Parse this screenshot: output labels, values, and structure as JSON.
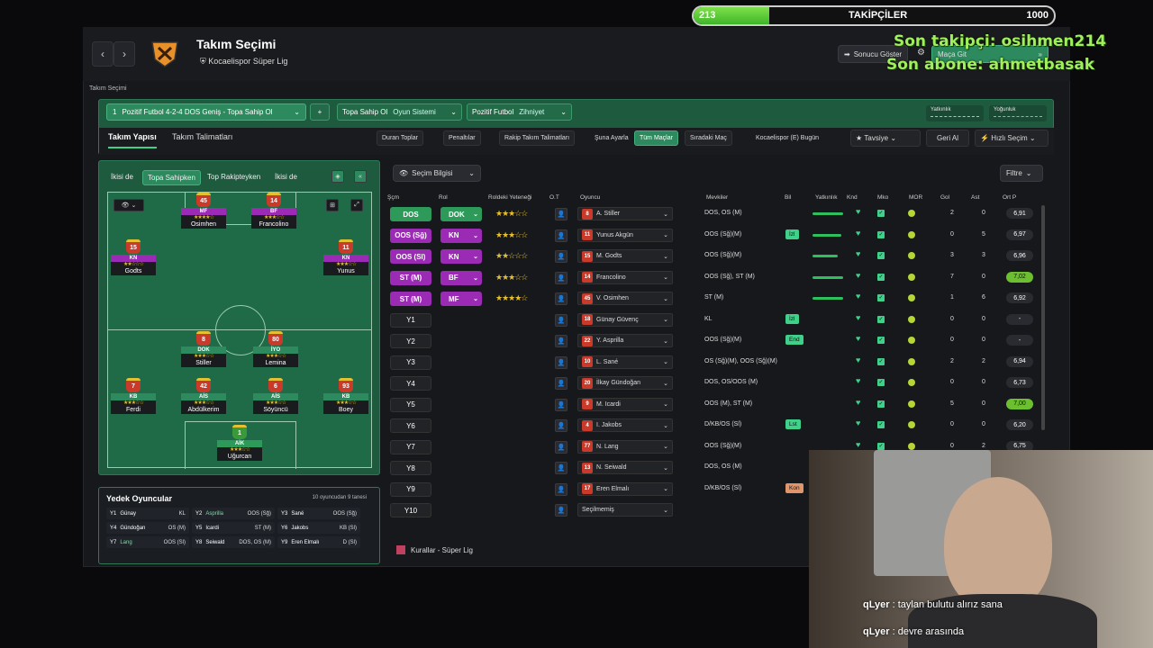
{
  "overlay": {
    "follow_label": "TAKİPÇİLER",
    "follow_current": "213",
    "follow_goal": "1000",
    "follow_progress": 0.21,
    "last_follower": "Son takipçi: osihmen214",
    "last_sub": "Son abone: ahmetbasak"
  },
  "header": {
    "title": "Takım Seçimi",
    "club": "Kocaelispor",
    "league": "Süper Lig",
    "show_result": "Sonucu Göster",
    "go_match": "Maça Git",
    "breadcrumb": "Takım Seçimi"
  },
  "tactic": {
    "num": "1",
    "name": "Pozitif Futbol 4-2-4 DOS Geniş - Topa Sahip Ol",
    "system_label": "Topa Sahip Ol",
    "system_kind": "Oyun Sistemi",
    "mentality_label": "Pozitif Futbol",
    "mentality_kind": "Zihniyet",
    "width_label": "Yatkınlık",
    "intensity_label": "Yoğunluk"
  },
  "tabs": [
    "Takım Yapısı",
    "Takım Talimatları"
  ],
  "toolbar": [
    "Duran Toplar",
    "Penaltılar",
    "Rakip Takım Talimatları",
    "Şuna Ayarla",
    "Tüm Maçlar",
    "Sıradaki Maç",
    "Kocaelispor (E)  Bugün",
    "Tavsiye",
    "Geri Al",
    "Hızlı Seçim"
  ],
  "phase_tabs": [
    "İkisi de",
    "Topa Sahipken",
    "Top Rakipteyken",
    "İkisi de"
  ],
  "pitch_players": [
    {
      "num": "45",
      "role": "MF",
      "stars": "★★★★☆",
      "name": "Osimhen"
    },
    {
      "num": "14",
      "role": "BF",
      "stars": "★★★☆☆",
      "name": "Francolino"
    },
    {
      "num": "15",
      "role": "KN",
      "stars": "★★☆☆☆",
      "name": "Godts"
    },
    {
      "num": "11",
      "role": "KN",
      "stars": "★★★☆☆",
      "name": "Yunus"
    },
    {
      "num": "8",
      "role": "DOK",
      "stars": "★★★☆☆",
      "name": "Stiller"
    },
    {
      "num": "80",
      "role": "İYO",
      "stars": "★★★☆☆",
      "name": "Lemina"
    },
    {
      "num": "7",
      "role": "KB",
      "stars": "★★★☆☆",
      "name": "Ferdi"
    },
    {
      "num": "42",
      "role": "AİS",
      "stars": "★★★☆☆",
      "name": "Abdülkerim"
    },
    {
      "num": "6",
      "role": "AİS",
      "stars": "★★★☆☆",
      "name": "Söyüncü"
    },
    {
      "num": "93",
      "role": "KB",
      "stars": "★★★☆☆",
      "name": "Boey"
    },
    {
      "num": "1",
      "role": "AİK",
      "stars": "★★★☆☆",
      "name": "Uğurcan"
    }
  ],
  "subs": {
    "title": "Yedek Oyuncular",
    "count": "10 oyuncudan 9 tanesi",
    "items": [
      {
        "s": "Y1",
        "n": "Günay",
        "p": "KL"
      },
      {
        "s": "Y2",
        "n": "Asprilla",
        "p": "OOS (Sğ)"
      },
      {
        "s": "Y3",
        "n": "Sané",
        "p": "OOS (Sğ)"
      },
      {
        "s": "Y4",
        "n": "Gündoğan",
        "p": "OS (M)"
      },
      {
        "s": "Y5",
        "n": "Icardi",
        "p": "ST (M)"
      },
      {
        "s": "Y6",
        "n": "Jakobs",
        "p": "KB (Sl)"
      },
      {
        "s": "Y7",
        "n": "Lang",
        "p": "OOS (Sl)"
      },
      {
        "s": "Y8",
        "n": "Seiwald",
        "p": "DOS, OS (M)"
      },
      {
        "s": "Y9",
        "n": "Eren Elmalı",
        "p": "D (Sl)"
      }
    ]
  },
  "table": {
    "selection_info": "Seçim Bilgisi",
    "filter": "Filtre",
    "footer": "Kurallar - Süper Lig",
    "headers": [
      "Şçm",
      "Rol",
      "Roldeki Yeteneği",
      "O.T",
      "Oyuncu",
      "Mevkiler",
      "Bil",
      "Yatkınlık",
      "Knd",
      "Mko",
      "MOR",
      "Gol",
      "Ast",
      "Ort P"
    ],
    "rows": [
      {
        "pos": "DOS",
        "posc": "g",
        "role": "DOK",
        "rolec": "g",
        "stars": "★★★☆☆",
        "num": "8",
        "name": "A. Stiller",
        "mev": "DOS, OS (M)",
        "bil": "",
        "fit": 0.85,
        "gol": "2",
        "ast": "0",
        "rat": "6,91",
        "ratg": false
      },
      {
        "pos": "OOS (Sğ)",
        "posc": "p",
        "role": "KN",
        "rolec": "p",
        "stars": "★★★☆☆",
        "num": "11",
        "name": "Yunus Akgün",
        "mev": "OOS (Sğ)(M)",
        "bil": "İzl",
        "fit": 0.8,
        "gol": "0",
        "ast": "5",
        "rat": "6,97",
        "ratg": false
      },
      {
        "pos": "OOS (Sl)",
        "posc": "p",
        "role": "KN",
        "rolec": "p",
        "stars": "★★☆☆☆",
        "num": "15",
        "name": "M. Godts",
        "mev": "OOS (Sğ)(M)",
        "bil": "",
        "fit": 0.7,
        "gol": "3",
        "ast": "3",
        "rat": "6,96",
        "ratg": false
      },
      {
        "pos": "ST (M)",
        "posc": "p",
        "role": "BF",
        "rolec": "p",
        "stars": "★★★☆☆",
        "num": "14",
        "name": "Francolino",
        "mev": "OOS (Sğ), ST (M)",
        "bil": "",
        "fit": 0.85,
        "gol": "7",
        "ast": "0",
        "rat": "7,02",
        "ratg": true
      },
      {
        "pos": "ST (M)",
        "posc": "p",
        "role": "MF",
        "rolec": "p",
        "stars": "★★★★☆",
        "num": "45",
        "name": "V. Osimhen",
        "mev": "ST (M)",
        "bil": "",
        "fit": 0.85,
        "gol": "1",
        "ast": "6",
        "rat": "6,92",
        "ratg": false
      },
      {
        "pos": "Y1",
        "posc": "d",
        "role": "",
        "rolec": "",
        "stars": "",
        "num": "18",
        "name": "Günay Güvenç",
        "mev": "KL",
        "bil": "İzl",
        "fit": 0,
        "gol": "0",
        "ast": "0",
        "rat": "-",
        "ratg": false
      },
      {
        "pos": "Y2",
        "posc": "d",
        "role": "",
        "rolec": "",
        "stars": "",
        "num": "22",
        "name": "Y. Asprilla",
        "mev": "OOS (Sğ)(M)",
        "bil": "End",
        "fit": 0,
        "gol": "0",
        "ast": "0",
        "rat": "-",
        "ratg": false
      },
      {
        "pos": "Y3",
        "posc": "d",
        "role": "",
        "rolec": "",
        "stars": "",
        "num": "10",
        "name": "L. Sané",
        "mev": "OS (Sğ)(M), OOS (Sğ)(M)",
        "bil": "",
        "fit": 0,
        "gol": "2",
        "ast": "2",
        "rat": "6,94",
        "ratg": false
      },
      {
        "pos": "Y4",
        "posc": "d",
        "role": "",
        "rolec": "",
        "stars": "",
        "num": "20",
        "name": "İlkay Gündoğan",
        "mev": "DOS, OS/OOS (M)",
        "bil": "",
        "fit": 0,
        "gol": "0",
        "ast": "0",
        "rat": "6,73",
        "ratg": false
      },
      {
        "pos": "Y5",
        "posc": "d",
        "role": "",
        "rolec": "",
        "stars": "",
        "num": "9",
        "name": "M. Icardi",
        "mev": "OOS (M), ST (M)",
        "bil": "",
        "fit": 0,
        "gol": "5",
        "ast": "0",
        "rat": "7,00",
        "ratg": true
      },
      {
        "pos": "Y6",
        "posc": "d",
        "role": "",
        "rolec": "",
        "stars": "",
        "num": "4",
        "name": "I. Jakobs",
        "mev": "D/KB/OS (Sl)",
        "bil": "Lst",
        "fit": 0,
        "gol": "0",
        "ast": "0",
        "rat": "6,20",
        "ratg": false
      },
      {
        "pos": "Y7",
        "posc": "d",
        "role": "",
        "rolec": "",
        "stars": "",
        "num": "77",
        "name": "N. Lang",
        "mev": "OOS (Sğ)(M)",
        "bil": "",
        "fit": 0,
        "gol": "0",
        "ast": "2",
        "rat": "6,75",
        "ratg": false
      },
      {
        "pos": "Y8",
        "posc": "d",
        "role": "",
        "rolec": "",
        "stars": "",
        "num": "13",
        "name": "N. Seiwald",
        "mev": "DOS, OS (M)",
        "bil": "",
        "fit": 0,
        "gol": "",
        "ast": "",
        "rat": "",
        "ratg": false
      },
      {
        "pos": "Y9",
        "posc": "d",
        "role": "",
        "rolec": "",
        "stars": "",
        "num": "17",
        "name": "Eren Elmalı",
        "mev": "D/KB/OS (Sl)",
        "bil": "Kon",
        "fit": 0,
        "gol": "",
        "ast": "",
        "rat": "",
        "ratg": false
      },
      {
        "pos": "Y10",
        "posc": "d",
        "role": "",
        "rolec": "",
        "stars": "",
        "num": "",
        "name": "Seçilmemiş",
        "mev": "",
        "bil": "",
        "fit": 0,
        "gol": "",
        "ast": "",
        "rat": "",
        "ratg": false
      }
    ]
  },
  "chat": [
    {
      "user": "qLyer",
      "msg": "taylan bulutu alırız sana"
    },
    {
      "user": "qLyer",
      "msg": "devre arasında"
    }
  ],
  "colors": {
    "accent": "#2d8a5e",
    "starter_pos": "#9b2bb5",
    "gk_pos": "#2d9a5a",
    "fill_green": "#7ee04a"
  }
}
